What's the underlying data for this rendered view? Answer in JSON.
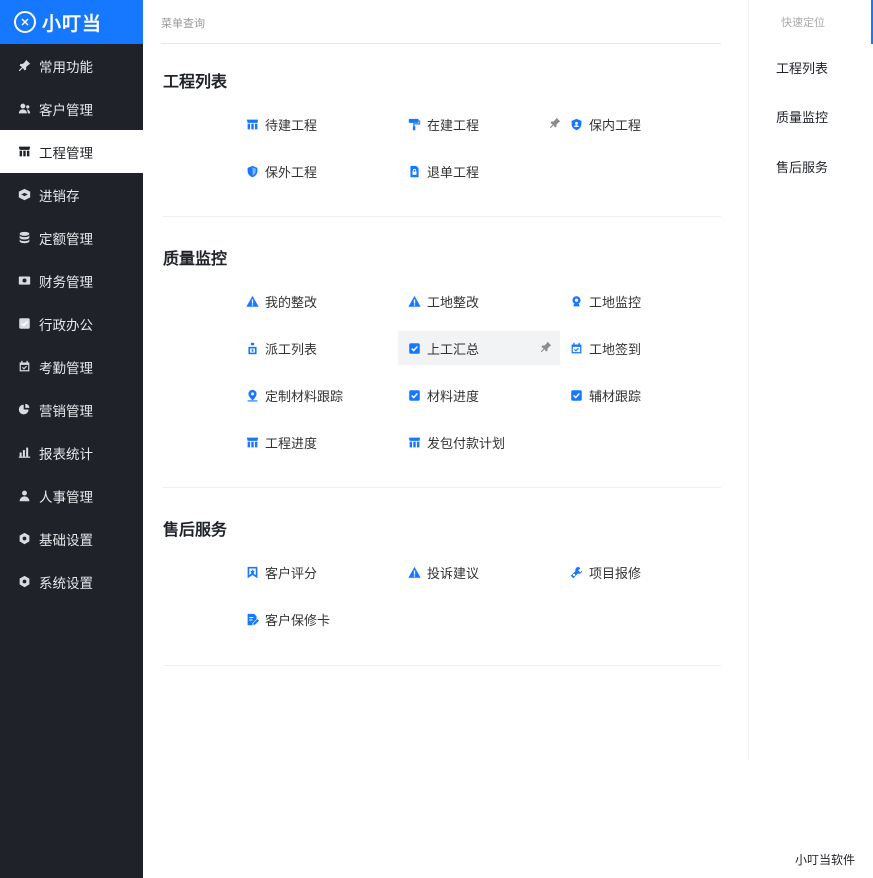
{
  "brand": {
    "logo": "ⓧ",
    "name": "小叮当"
  },
  "sidebar": {
    "items": [
      {
        "label": "常用功能",
        "icon": "pin-icon"
      },
      {
        "label": "客户管理",
        "icon": "users-icon"
      },
      {
        "label": "工程管理",
        "icon": "store-icon",
        "active": true
      },
      {
        "label": "进销存",
        "icon": "cube-icon"
      },
      {
        "label": "定额管理",
        "icon": "database-icon"
      },
      {
        "label": "财务管理",
        "icon": "money-icon"
      },
      {
        "label": "行政办公",
        "icon": "check-square-icon"
      },
      {
        "label": "考勤管理",
        "icon": "calendar-check-icon"
      },
      {
        "label": "营销管理",
        "icon": "pie-icon"
      },
      {
        "label": "报表统计",
        "icon": "chart-icon"
      },
      {
        "label": "人事管理",
        "icon": "user-group-icon"
      },
      {
        "label": "基础设置",
        "icon": "gear-icon"
      },
      {
        "label": "系统设置",
        "icon": "gear-icon"
      }
    ]
  },
  "breadcrumb": "菜单查询",
  "sections": [
    {
      "title": "工程列表",
      "items": [
        {
          "label": "待建工程",
          "icon": "store-icon"
        },
        {
          "label": "在建工程",
          "icon": "paint-roller-icon",
          "pinned": true
        },
        {
          "label": "保内工程",
          "icon": "shield-user-icon"
        },
        {
          "label": "保外工程",
          "icon": "shield-icon"
        },
        {
          "label": "退单工程",
          "icon": "file-lock-icon"
        }
      ]
    },
    {
      "title": "质量监控",
      "items": [
        {
          "label": "我的整改",
          "icon": "warning-icon"
        },
        {
          "label": "工地整改",
          "icon": "warning-icon"
        },
        {
          "label": "工地监控",
          "icon": "webcam-icon"
        },
        {
          "label": "派工列表",
          "icon": "worker-icon"
        },
        {
          "label": "上工汇总",
          "icon": "check-square-icon",
          "pinned": true,
          "hover": true
        },
        {
          "label": "工地签到",
          "icon": "calendar-check-icon"
        },
        {
          "label": "定制材料跟踪",
          "icon": "location-icon"
        },
        {
          "label": "材料进度",
          "icon": "check-square-icon"
        },
        {
          "label": "辅材跟踪",
          "icon": "check-square-icon"
        },
        {
          "label": "工程进度",
          "icon": "store-icon"
        },
        {
          "label": "发包付款计划",
          "icon": "store-icon"
        }
      ]
    },
    {
      "title": "售后服务",
      "items": [
        {
          "label": "客户评分",
          "icon": "bookmark-icon"
        },
        {
          "label": "投诉建议",
          "icon": "warning-icon"
        },
        {
          "label": "项目报修",
          "icon": "tools-icon"
        },
        {
          "label": "客户保修卡",
          "icon": "file-edit-icon"
        }
      ]
    }
  ],
  "quick_nav": {
    "title": "快速定位",
    "items": [
      "工程列表",
      "质量监控",
      "售后服务"
    ]
  },
  "footer_brand": "小叮当软件",
  "colors": {
    "accent": "#1677ff",
    "sidebar_bg": "#1f2229"
  }
}
